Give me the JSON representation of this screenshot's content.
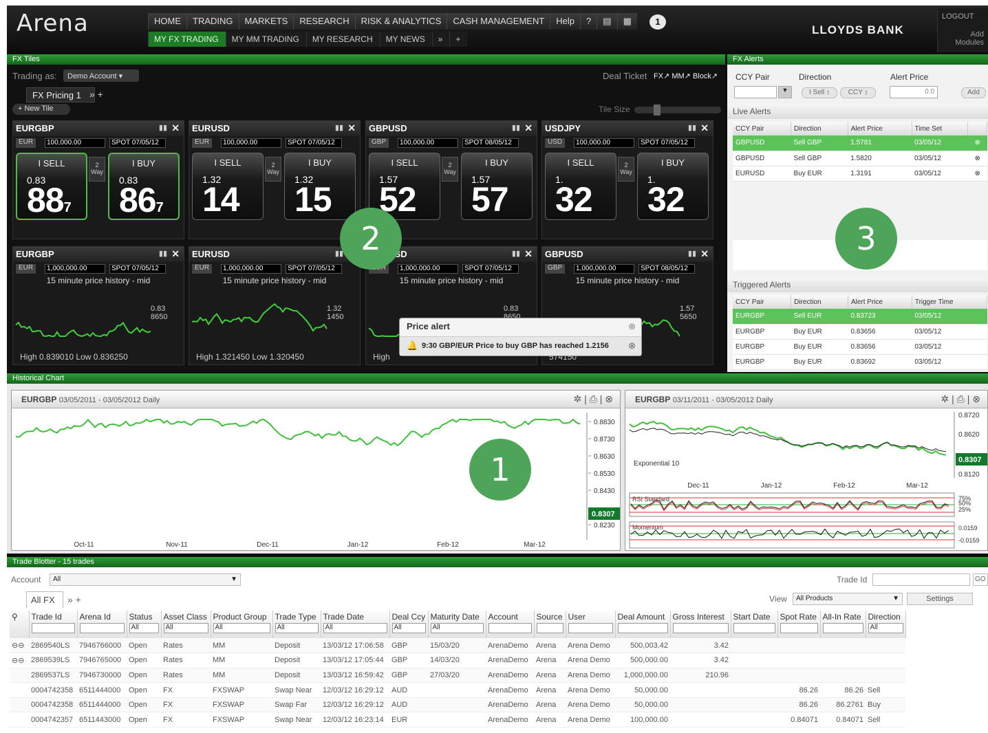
{
  "app": {
    "logo": "Arena",
    "bank": "LLOYDS BANK",
    "logout": "LOGOUT",
    "add_modules": "Add Modules",
    "notif": "1"
  },
  "nav": [
    "HOME",
    "TRADING",
    "MARKETS",
    "RESEARCH",
    "RISK & ANALYTICS",
    "CASH MANAGEMENT",
    "Help"
  ],
  "subnav": [
    "MY FX TRADING",
    "MY MM TRADING",
    "MY RESEARCH",
    "MY NEWS"
  ],
  "fx_tiles": {
    "title": "FX Tiles",
    "trading_as": "Trading as:",
    "account": "Demo Account",
    "deal_ticket": "Deal Ticket",
    "dt_links": [
      "FX",
      "MM",
      "Block"
    ],
    "tab": "FX Pricing 1",
    "new_tile": "New Tile",
    "tile_size": "Tile Size",
    "price_tiles": [
      {
        "pair": "EURGBP",
        "ccy": "EUR",
        "amount": "100,000.00",
        "spot": "SPOT 07/05/12",
        "sell_small": "0.83",
        "sell_big": "88",
        "sell_pip": "7",
        "buy_small": "0.83",
        "buy_big": "86",
        "buy_pip": "7"
      },
      {
        "pair": "EURUSD",
        "ccy": "EUR",
        "amount": "100,000.00",
        "spot": "SPOT 07/05/12",
        "sell_small": "1.32",
        "sell_big": "14",
        "sell_pip": "",
        "buy_small": "1.32",
        "buy_big": "15",
        "buy_pip": ""
      },
      {
        "pair": "GBPUSD",
        "ccy": "GBP",
        "amount": "100,000.00",
        "spot": "SPOT 08/05/12",
        "sell_small": "1.57",
        "sell_big": "52",
        "sell_pip": "",
        "buy_small": "1.57",
        "buy_big": "57",
        "buy_pip": ""
      },
      {
        "pair": "USDJPY",
        "ccy": "USD",
        "amount": "100,000.00",
        "spot": "SPOT 07/05/12",
        "sell_small": "1.",
        "sell_big": "32",
        "sell_pip": "",
        "buy_small": "1.",
        "buy_big": "32",
        "buy_pip": ""
      }
    ],
    "sell_label": "I SELL",
    "buy_label": "I BUY",
    "way": "2 Way",
    "history_tiles": [
      {
        "pair": "EURGBP",
        "ccy": "EUR",
        "amount": "1,000,000.00",
        "spot": "SPOT 07/05/12",
        "hl": "High 0.839010  Low 0.836250",
        "last": "0.83 8650"
      },
      {
        "pair": "EURUSD",
        "ccy": "EUR",
        "amount": "1,000,000.00",
        "spot": "SPOT 07/05/12",
        "hl": "High 1.321450  Low 1.320450",
        "last": "1.32 1450"
      },
      {
        "pair": "GBPUSD",
        "ccy": "EUR",
        "amount": "1,000,000.00",
        "spot": "SPOT 07/05/12",
        "hl": "High",
        "last": "0.83 8650"
      },
      {
        "pair": "GBPUSD",
        "ccy": "GBP",
        "amount": "1,000,000.00",
        "spot": "SPOT 08/05/12",
        "hl": "574150",
        "last": "1.57 5650"
      }
    ],
    "history_label": "15 minute price history - mid"
  },
  "popup": {
    "title": "Price alert",
    "msg": "9:30 GBP/EUR  Price to buy GBP has reached 1.2156"
  },
  "markers": [
    "1",
    "2",
    "3"
  ],
  "fx_alerts": {
    "title": "FX Alerts",
    "ccy_pair": "CCY Pair",
    "direction": "Direction",
    "alert_price": "Alert Price",
    "sell": "I Sell",
    "ccy": "CCY",
    "price": "0.0",
    "add": "Add",
    "live_title": "Live Alerts",
    "live_cols": [
      "CCY Pair",
      "Direction",
      "Alert Price",
      "Time Set"
    ],
    "live": [
      [
        "GBPUSD",
        "Sell GBP",
        "1.5781",
        "03/05/12"
      ],
      [
        "GBPUSD",
        "Sell GBP",
        "1.5820",
        "03/05/12"
      ],
      [
        "EURUSD",
        "Buy EUR",
        "1.3191",
        "03/05/12"
      ]
    ],
    "trig_title": "Triggered Alerts",
    "trig_cols": [
      "CCY Pair",
      "Direction",
      "Alert Price",
      "Trigger Time"
    ],
    "trig": [
      [
        "EURGBP",
        "Sell EUR",
        "0.83723",
        "03/05/12"
      ],
      [
        "EURGBP",
        "Buy EUR",
        "0.83656",
        "03/05/12"
      ],
      [
        "EURGBP",
        "Buy EUR",
        "0.83656",
        "03/05/12"
      ],
      [
        "EURGBP",
        "Buy EUR",
        "0.83692",
        "03/05/12"
      ]
    ]
  },
  "hist": {
    "title": "Historical Chart",
    "left": {
      "pair": "EURGBP",
      "range": "03/05/2011 - 03/05/2012 Daily",
      "last": "0.8307",
      "x_labels": [
        "Oct-11",
        "Nov-11",
        "Dec-11",
        "Jan-12",
        "Feb-12",
        "Mar-12"
      ],
      "y_labels": [
        "0.8830",
        "0.8730",
        "0.8630",
        "0.8530",
        "0.8430",
        "0.8230"
      ]
    },
    "right": {
      "pair": "EURGBP",
      "range": "03/11/2011 - 03/05/2012 Daily",
      "last": "0.8307",
      "ema": "Exponential 10",
      "rsi": "RSI Standard",
      "mom": "Momentum",
      "x_labels": [
        "Dec-11",
        "Jan-12",
        "Feb-12",
        "Mar-12"
      ],
      "y_labels": [
        "0.8720",
        "0.8620",
        "0.8120"
      ],
      "rsi_labels": [
        "75%",
        "50%",
        "25%"
      ],
      "mom_labels": [
        "0.0159",
        "-0.0159"
      ]
    }
  },
  "blotter": {
    "title": "Trade Blotter - 15 trades",
    "account": "Account",
    "account_val": "All",
    "trade_id": "Trade Id",
    "tab": "All FX",
    "view": "View",
    "view_val": "All Products",
    "settings": "Settings",
    "all": "All",
    "cols": [
      "Trade Id",
      "Arena Id",
      "Status",
      "Asset Class",
      "Product Group",
      "Trade Type",
      "Trade Date",
      "Deal Ccy",
      "Maturity Date",
      "Account",
      "Source",
      "User",
      "Deal Amount",
      "Gross Interest",
      "Start Date",
      "Spot Rate",
      "All-In Rate",
      "Direction"
    ],
    "rows": [
      [
        "2869540LS",
        "7946766000",
        "Open",
        "Rates",
        "MM",
        "Deposit",
        "13/03/12 17:06:58",
        "GBP",
        "15/03/20",
        "ArenaDemo",
        "Arena",
        "Arena Demo",
        "500,003.42",
        "3.42",
        "",
        "",
        "",
        ""
      ],
      [
        "2869539LS",
        "7946765000",
        "Open",
        "Rates",
        "MM",
        "Deposit",
        "13/03/12 17:05:44",
        "GBP",
        "14/03/20",
        "ArenaDemo",
        "Arena",
        "Arena Demo",
        "500,000.00",
        "3.42",
        "",
        "",
        "",
        ""
      ],
      [
        "2869537LS",
        "7946730000",
        "Open",
        "Rates",
        "MM",
        "Deposit",
        "13/03/12 16:59:42",
        "GBP",
        "27/03/20",
        "ArenaDemo",
        "Arena",
        "Arena Demo",
        "1,000,000.00",
        "210.96",
        "",
        "",
        "",
        ""
      ],
      [
        "0004742358",
        "6511444000",
        "Open",
        "FX",
        "FXSWAP",
        "Swap Near",
        "12/03/12 16:29:12",
        "AUD",
        "",
        "ArenaDemo",
        "Arena",
        "Arena Demo",
        "50,000.00",
        "",
        "",
        "86.26",
        "86.26",
        "Sell"
      ],
      [
        "0004742358",
        "6511444000",
        "Open",
        "FX",
        "FXSWAP",
        "Swap Far",
        "12/03/12 16:29:12",
        "AUD",
        "",
        "ArenaDemo",
        "Arena",
        "Arena Demo",
        "50,000.00",
        "",
        "",
        "86.26",
        "86.2761",
        "Buy"
      ],
      [
        "0004742357",
        "6511443000",
        "Open",
        "FX",
        "FXSWAP",
        "Swap Near",
        "12/03/12 16:23:14",
        "EUR",
        "",
        "ArenaDemo",
        "Arena",
        "Arena Demo",
        "100,000.00",
        "",
        "",
        "0.84071",
        "0.84071",
        "Sell"
      ]
    ]
  }
}
